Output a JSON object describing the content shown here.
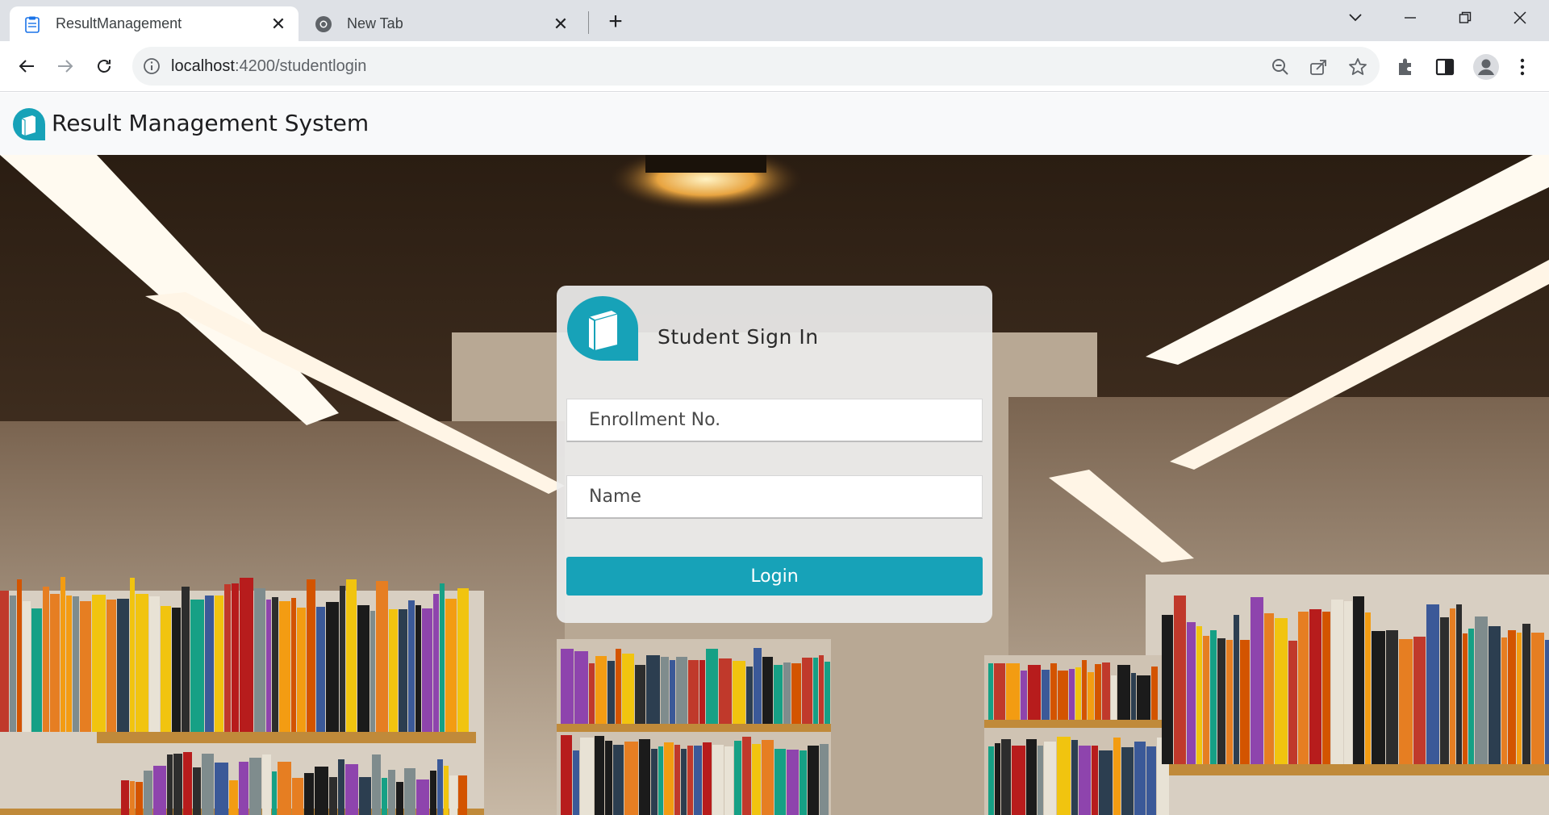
{
  "browser": {
    "tabs": [
      {
        "title": "ResultManagement",
        "active": true,
        "favicon": "clipboard-icon"
      },
      {
        "title": "New Tab",
        "active": false,
        "favicon": "chrome-icon"
      }
    ],
    "url_host": "localhost",
    "url_rest": ":4200/studentlogin"
  },
  "navbar": {
    "brand": "Result Management System",
    "logo_icon": "book-icon"
  },
  "login_card": {
    "heading": "Student Sign In",
    "enrollment_placeholder": "Enrollment No.",
    "enrollment_value": "",
    "name_placeholder": "Name",
    "name_value": "",
    "login_label": "Login"
  },
  "colors": {
    "accent": "#17a2b8",
    "navbar_bg": "#f8f9fa",
    "tabstrip_bg": "#dee1e6"
  }
}
